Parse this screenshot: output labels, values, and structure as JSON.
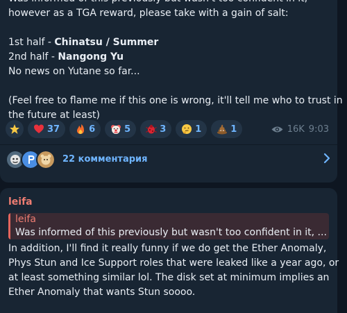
{
  "post": {
    "lines": [
      "Was informed of this previously but wasn't too confident in it,",
      "however as a TGA reward, please take with a gain of salt:",
      "",
      "1st half - ",
      "2nd half - ",
      "No news on Yutane so far...",
      "",
      "(Feel free to flame me if this one is wrong, it'll tell me who to trust in",
      "the future at least)"
    ],
    "first_half_name": "Chinatsu / Summer",
    "second_half_name": "Nangong Yu",
    "reactions": [
      {
        "emoji": "star",
        "count": ""
      },
      {
        "emoji": "red-heart",
        "count": "37"
      },
      {
        "emoji": "fire",
        "count": "6"
      },
      {
        "emoji": "clown-face",
        "count": "5"
      },
      {
        "emoji": "red-bug",
        "count": "3"
      },
      {
        "emoji": "thinking-face",
        "count": "1"
      },
      {
        "emoji": "pile-of-poo",
        "count": "1"
      }
    ],
    "views": "16K",
    "time": "9:03",
    "comments_label": "22 комментария"
  },
  "reply": {
    "author": "leifa",
    "quote_author": "leifa",
    "quote_text": "Was informed of this previously but wasn't too confident in it, ...",
    "lines": [
      "In addition, I'll find it really funny if we do get the Ether Anomaly,",
      "Phys Stun and Ice Support roles that were leaked like a year ago, or",
      "at least something similar lol. The disk set at minimum implies an",
      "Ether Anomaly that wants Stun soooo."
    ]
  },
  "colors": {
    "background": "#0e1621",
    "bubble": "#182533",
    "accent": "#6fb5ff",
    "author": "#ee7d72"
  }
}
